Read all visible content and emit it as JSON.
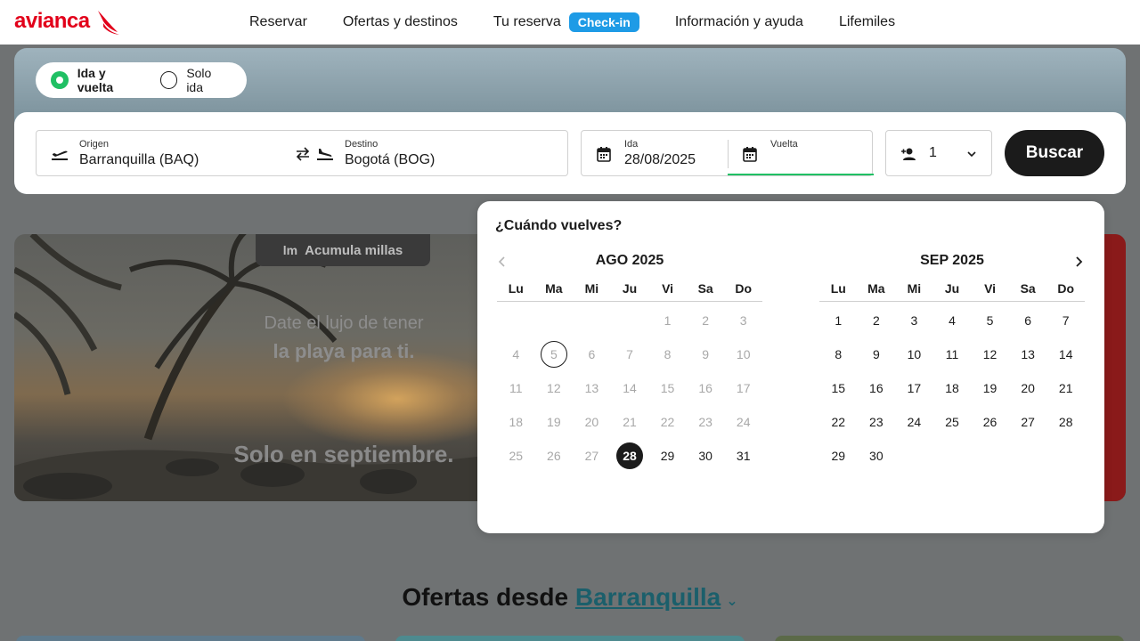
{
  "header": {
    "brand": "avianca",
    "nav": [
      {
        "label": "Reservar"
      },
      {
        "label": "Ofertas y destinos"
      },
      {
        "label": "Tu reserva",
        "badge": "Check-in"
      },
      {
        "label": "Información y ayuda"
      },
      {
        "label": "Lifemiles"
      }
    ]
  },
  "trip_type": {
    "options": [
      "Ida y vuelta",
      "Solo ida"
    ],
    "selected": "Ida y vuelta"
  },
  "search": {
    "origin_label": "Origen",
    "origin_value": "Barranquilla  (BAQ)",
    "destination_label": "Destino",
    "destination_value": "Bogotá  (BOG)",
    "depart_label": "Ida",
    "depart_value": "28/08/2025",
    "return_label": "Vuelta",
    "return_value": "",
    "passengers": "1",
    "button": "Buscar"
  },
  "promo": {
    "badge": "Acumula millas",
    "badge_logo": "lm",
    "line1": "Date el lujo de tener",
    "line2": "la playa para ti.",
    "line3": "Solo en septiembre."
  },
  "calendar": {
    "question": "¿Cuándo vuelves?",
    "weekdays": [
      "Lu",
      "Ma",
      "Mi",
      "Ju",
      "Vi",
      "Sa",
      "Do"
    ],
    "months": [
      {
        "title": "AGO 2025",
        "first_weekday": 4,
        "days": 31,
        "enabled_from": 28,
        "today": 5,
        "selected": 28
      },
      {
        "title": "SEP 2025",
        "first_weekday": 0,
        "days": 30,
        "enabled_from": 1,
        "today": null,
        "selected": null
      }
    ]
  },
  "offers": {
    "prefix": "Ofertas desde",
    "city": "Barranquilla"
  },
  "colors": {
    "brand_red": "#e2001a",
    "accent_green": "#20c064",
    "checkin_blue": "#1e9be6",
    "dark": "#1b1b1b"
  }
}
